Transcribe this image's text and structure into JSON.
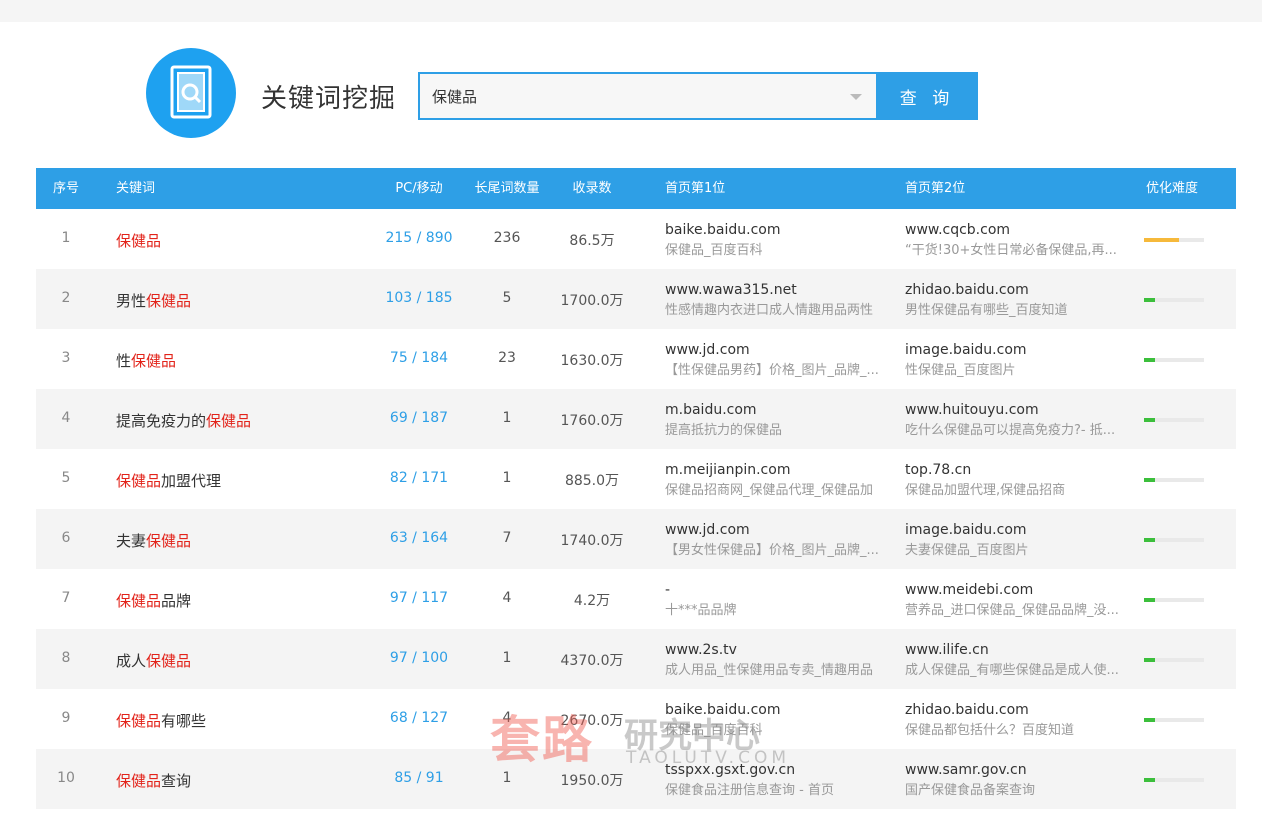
{
  "header": {
    "app_title": "关键词挖掘",
    "search_value": "保健品",
    "search_button": "查 询",
    "logo_icon": "search-document-icon",
    "accent_color": "#2e9fe6"
  },
  "table": {
    "columns": [
      "序号",
      "关键词",
      "PC/移动",
      "长尾词数量",
      "收录数",
      "首页第1位",
      "首页第2位",
      "优化难度"
    ],
    "rows": [
      {
        "index": "1",
        "kw_pre": "",
        "kw_hl": "保健品",
        "kw_post": "",
        "pc": "215 / 890",
        "longtail": "236",
        "indexed": "86.5万",
        "s1_domain": "baike.baidu.com",
        "s1_desc": "保健品_百度百科",
        "s2_domain": "www.cqcb.com",
        "s2_desc": "“干货!30+女性日常必备保健品,再...",
        "difficulty": 0.58,
        "difficulty_color": "#f6b93b"
      },
      {
        "index": "2",
        "kw_pre": "男性",
        "kw_hl": "保健品",
        "kw_post": "",
        "pc": "103 / 185",
        "longtail": "5",
        "indexed": "1700.0万",
        "s1_domain": "www.wawa315.net",
        "s1_desc": "性感情趣内衣进口成人情趣用品两性",
        "s2_domain": "zhidao.baidu.com",
        "s2_desc": "男性保健品有哪些_百度知道",
        "difficulty": 0.18,
        "difficulty_color": "#3cbf3c"
      },
      {
        "index": "3",
        "kw_pre": "性",
        "kw_hl": "保健品",
        "kw_post": "",
        "pc": "75 / 184",
        "longtail": "23",
        "indexed": "1630.0万",
        "s1_domain": "www.jd.com",
        "s1_desc": "【性保健品男药】价格_图片_品牌_...",
        "s2_domain": "image.baidu.com",
        "s2_desc": "性保健品_百度图片",
        "difficulty": 0.18,
        "difficulty_color": "#3cbf3c"
      },
      {
        "index": "4",
        "kw_pre": "提高免疫力的",
        "kw_hl": "保健品",
        "kw_post": "",
        "pc": "69 / 187",
        "longtail": "1",
        "indexed": "1760.0万",
        "s1_domain": "m.baidu.com",
        "s1_desc": "提高抵抗力的保健品",
        "s2_domain": "www.huitouyu.com",
        "s2_desc": "吃什么保健品可以提高免疫力?- 抵...",
        "difficulty": 0.18,
        "difficulty_color": "#3cbf3c"
      },
      {
        "index": "5",
        "kw_pre": "",
        "kw_hl": "保健品",
        "kw_post": "加盟代理",
        "pc": "82 / 171",
        "longtail": "1",
        "indexed": "885.0万",
        "s1_domain": "m.meijianpin.com",
        "s1_desc": "保健品招商网_保健品代理_保健品加",
        "s2_domain": "top.78.cn",
        "s2_desc": "保健品加盟代理,保健品招商",
        "difficulty": 0.18,
        "difficulty_color": "#3cbf3c"
      },
      {
        "index": "6",
        "kw_pre": "夫妻",
        "kw_hl": "保健品",
        "kw_post": "",
        "pc": "63 / 164",
        "longtail": "7",
        "indexed": "1740.0万",
        "s1_domain": "www.jd.com",
        "s1_desc": "【男女性保健品】价格_图片_品牌_...",
        "s2_domain": "image.baidu.com",
        "s2_desc": "夫妻保健品_百度图片",
        "difficulty": 0.18,
        "difficulty_color": "#3cbf3c"
      },
      {
        "index": "7",
        "kw_pre": "",
        "kw_hl": "保健品",
        "kw_post": "品牌",
        "pc": "97 / 117",
        "longtail": "4",
        "indexed": "4.2万",
        "s1_domain": "-",
        "s1_desc": "十***品品牌",
        "s2_domain": "www.meidebi.com",
        "s2_desc": "营养品_进口保健品_保健品品牌_没...",
        "difficulty": 0.18,
        "difficulty_color": "#3cbf3c"
      },
      {
        "index": "8",
        "kw_pre": "成人",
        "kw_hl": "保健品",
        "kw_post": "",
        "pc": "97 / 100",
        "longtail": "1",
        "indexed": "4370.0万",
        "s1_domain": "www.2s.tv",
        "s1_desc": "成人用品_性保健用品专卖_情趣用品",
        "s2_domain": "www.ilife.cn",
        "s2_desc": "成人保健品_有哪些保健品是成人使...",
        "difficulty": 0.18,
        "difficulty_color": "#3cbf3c"
      },
      {
        "index": "9",
        "kw_pre": "",
        "kw_hl": "保健品",
        "kw_post": "有哪些",
        "pc": "68 / 127",
        "longtail": "4",
        "indexed": "2670.0万",
        "s1_domain": "baike.baidu.com",
        "s1_desc": "保健品_百度百科",
        "s2_domain": "zhidao.baidu.com",
        "s2_desc": "保健品都包括什么？百度知道",
        "difficulty": 0.18,
        "difficulty_color": "#3cbf3c"
      },
      {
        "index": "10",
        "kw_pre": "",
        "kw_hl": "保健品",
        "kw_post": "查询",
        "pc": "85 / 91",
        "longtail": "1",
        "indexed": "1950.0万",
        "s1_domain": "tsspxx.gsxt.gov.cn",
        "s1_desc": "保健食品注册信息查询 - 首页",
        "s2_domain": "www.samr.gov.cn",
        "s2_desc": "国产保健食品备案查询",
        "difficulty": 0.18,
        "difficulty_color": "#3cbf3c"
      }
    ]
  },
  "watermark": {
    "brand_cn": "套路",
    "brand_cn_sub": "研究中心",
    "brand_en": "TAOLUTV.COM"
  }
}
